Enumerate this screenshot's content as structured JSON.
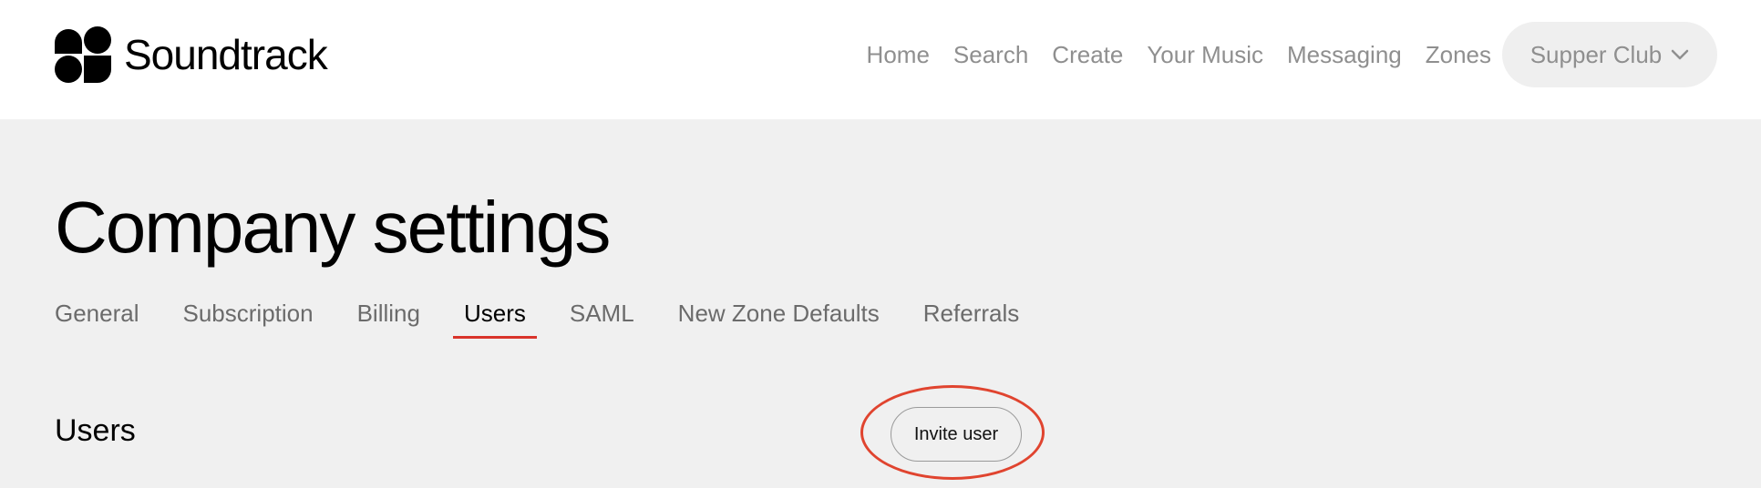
{
  "brand": {
    "name": "Soundtrack",
    "logo_icon": "soundtrack-logo-icon"
  },
  "nav": {
    "items": [
      "Home",
      "Search",
      "Create",
      "Your Music",
      "Messaging",
      "Zones"
    ],
    "account": {
      "label": "Supper Club",
      "icon": "chevron-down-icon"
    }
  },
  "page": {
    "title": "Company settings"
  },
  "tabs": [
    {
      "label": "General",
      "active": false
    },
    {
      "label": "Subscription",
      "active": false
    },
    {
      "label": "Billing",
      "active": false
    },
    {
      "label": "Users",
      "active": true
    },
    {
      "label": "SAML",
      "active": false
    },
    {
      "label": "New Zone Defaults",
      "active": false
    },
    {
      "label": "Referrals",
      "active": false
    }
  ],
  "section": {
    "title": "Users",
    "invite_label": "Invite user"
  },
  "colors": {
    "accent": "#d9342b",
    "annotation_circle": "#e0442f",
    "nav_text": "#8f8f8f",
    "background": "#f0f0f0"
  }
}
